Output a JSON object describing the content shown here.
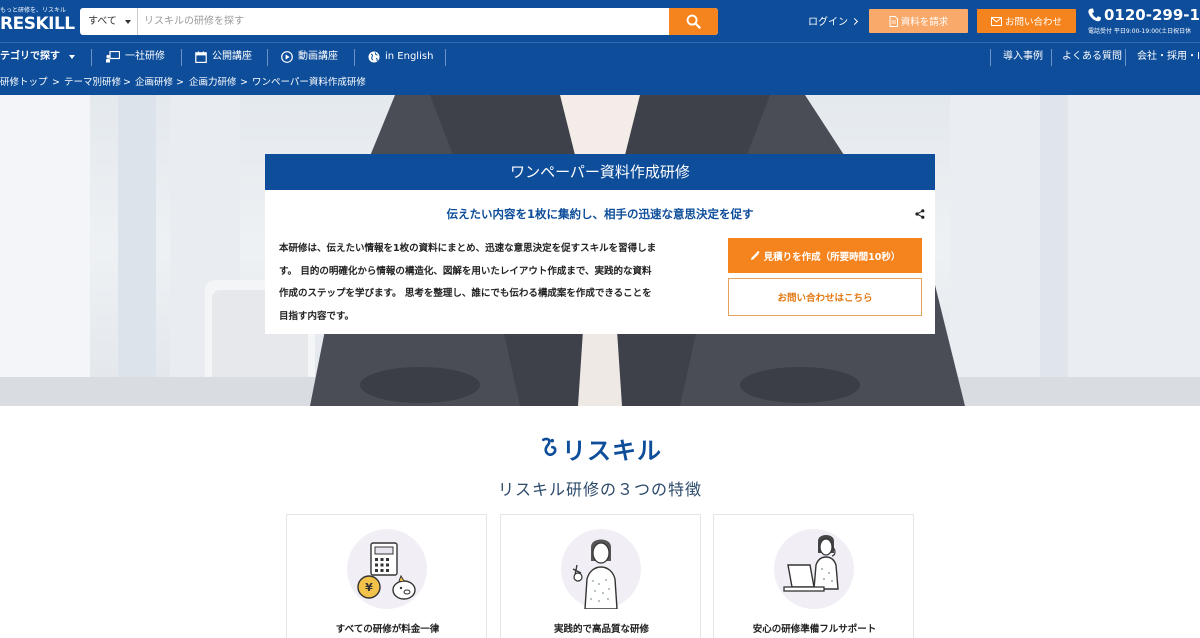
{
  "header": {
    "logo_tagline": "もっと研修を、リスキル",
    "logo_text": "RESKILL",
    "search_category": "すべて",
    "search_placeholder": "リスキルの研修を探す",
    "login_label": "ログイン",
    "document_button": "資料を請求",
    "contact_button": "お問い合わせ",
    "phone_number": "0120-299-1",
    "phone_hours": "電話受付 平日9:00-19:00(土日祝日休",
    "accent_color": "#f5841f",
    "brand_color": "#0d4d9a"
  },
  "nav": {
    "category": "テゴリで探す",
    "items": [
      {
        "label": "一社研修",
        "icon": "classroom-icon"
      },
      {
        "label": "公開講座",
        "icon": "calendar-icon"
      },
      {
        "label": "動画講座",
        "icon": "play-icon"
      },
      {
        "label": "in English",
        "icon": "globe-icon"
      }
    ],
    "right_items": [
      "導入事例",
      "よくある質問",
      "会社・採用・IR"
    ]
  },
  "breadcrumb": [
    "研修トップ",
    "テーマ別研修",
    "企画研修",
    "企画力研修",
    "ワンペーパー資料作成研修"
  ],
  "hero": {
    "title": "ワンペーパー資料作成研修",
    "subtitle": "伝えたい内容を1枚に集約し、相手の迅速な意思決定を促す",
    "description_lines": [
      "本研修は、伝えたい情報を1枚の資料にまとめ、迅速な意思決定を促すスキルを習得しま",
      "す。 目的の明確化から情報の構造化、図解を用いたレイアウト作成まで、実践的な資料",
      "作成のステップを学びます。 思考を整理し、誰にでも伝わる構成案を作成できることを",
      "目指す内容です。"
    ],
    "estimate_button": "見積りを作成（所要時間10秒）",
    "inquiry_button": "お問い合わせはこちら"
  },
  "features": {
    "brand_name": "リスキル",
    "title": "リスキル研修の３つの特徴",
    "cards": [
      {
        "label": "すべての研修が料金一律",
        "icon": "calculator-piggybank-icon"
      },
      {
        "label": "実践的で高品質な研修",
        "icon": "instructor-icon"
      },
      {
        "label": "安心の研修準備フルサポート",
        "icon": "support-operator-icon"
      }
    ]
  }
}
